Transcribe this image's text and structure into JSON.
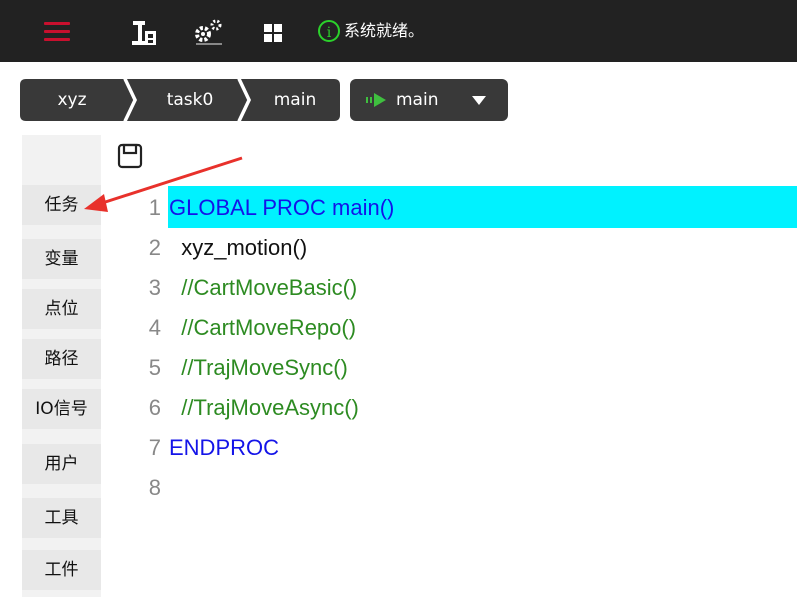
{
  "topbar": {
    "status_text": "系统就绪。",
    "info_symbol": "i",
    "icons": [
      "menu-icon",
      "robot-icon",
      "gears-icon",
      "grid-icon",
      "info-icon"
    ]
  },
  "breadcrumb": {
    "items": [
      "xyz",
      "task0",
      "main"
    ]
  },
  "proc_selector": {
    "label": "main"
  },
  "sidebar": {
    "items": [
      "任务",
      "变量",
      "点位",
      "路径",
      "IO信号",
      "用户",
      "工具",
      "工件"
    ]
  },
  "code": {
    "lines": [
      {
        "num": "1",
        "text": "GLOBAL PROC main()",
        "kind": "keyword"
      },
      {
        "num": "2",
        "text": "  xyz_motion()",
        "kind": "plain"
      },
      {
        "num": "3",
        "text": "  //CartMoveBasic()",
        "kind": "comment"
      },
      {
        "num": "4",
        "text": "  //CartMoveRepo()",
        "kind": "comment"
      },
      {
        "num": "5",
        "text": "  //TrajMoveSync()",
        "kind": "comment"
      },
      {
        "num": "6",
        "text": "  //TrajMoveAsync()",
        "kind": "comment"
      },
      {
        "num": "7",
        "text": "ENDPROC",
        "kind": "keyword"
      },
      {
        "num": "8",
        "text": "",
        "kind": "plain"
      }
    ]
  },
  "colors": {
    "topbar_bg": "#222222",
    "accent_red": "#c8102e",
    "status_green": "#2bd12b",
    "highlight": "#00f2ff",
    "keyword": "#1414e8",
    "comment": "#2d8b22",
    "annotation_arrow": "#e8312b"
  }
}
